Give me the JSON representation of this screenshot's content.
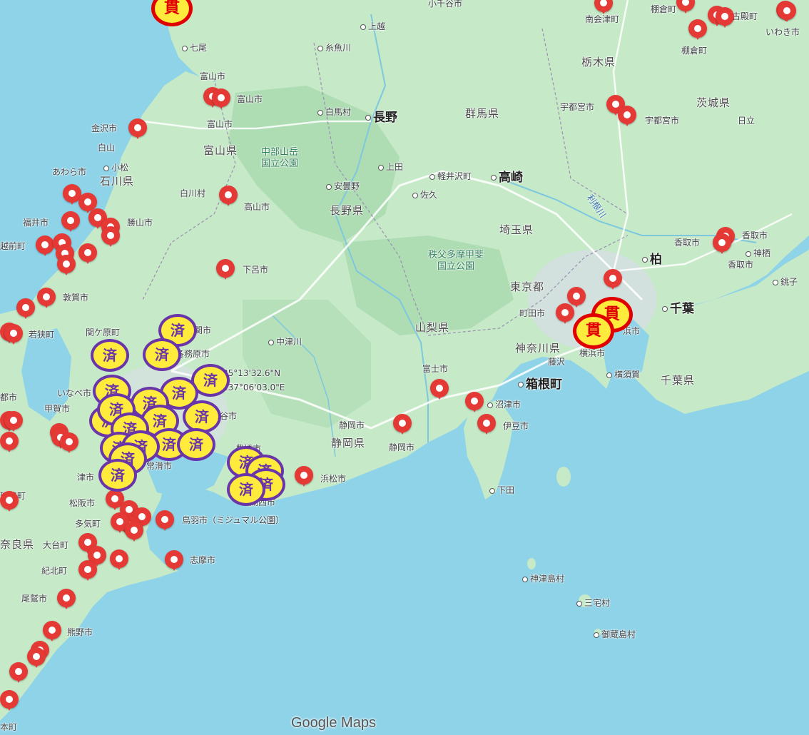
{
  "attribution": "Google Maps",
  "colors": {
    "sea": "#8fd3e8",
    "land": "#bfe6c4",
    "mountain": "#a9d9b0",
    "pin": "#e53935",
    "sumi_border": "#6a35a8",
    "kan_border": "#e00000",
    "marker_fill": "#ffeb3b"
  },
  "coordinate_readout": {
    "lat": "35°13'32.6\"N",
    "lng": "137°06'03.0\"E"
  },
  "marker_text": {
    "sumi": "済",
    "kan": "貫"
  },
  "labels": {
    "komagane": "小千谷市",
    "minamiaizu": "南会津町",
    "tanakura": "棚倉町",
    "furudono": "古殿町",
    "iwaki": "いわき市",
    "tanakura2": "棚倉町",
    "tochigi": "栃木県",
    "ibaraki": "茨城県",
    "utsunomiya": "宇都宮市",
    "utsunomiya2": "宇都宮市",
    "hitachi": "日立",
    "nanao": "七尾",
    "itoigawa": "糸魚川",
    "joetsu": "上越",
    "toyama_city": "富山市",
    "toyama_city2": "富山市",
    "kanazawa": "金沢市",
    "hakusan": "白山",
    "komatsu": "小松",
    "awara": "あわら市",
    "ishikawa": "石川県",
    "fukui": "福井市",
    "echizen": "越前町",
    "katsuyama": "勝山市",
    "hakuba": "白馬村",
    "nagano": "長野",
    "gunma": "群馬県",
    "toyama_pref": "富山県",
    "chubu_park": "中部山岳\n国立公園",
    "joda": "上田",
    "karuizawa": "軽井沢町",
    "takasaki": "高崎",
    "azumino": "安曇野",
    "saku": "佐久",
    "shirakawa": "白川村",
    "takayama": "高山市",
    "nagano_pref": "長野県",
    "saitama": "埼玉県",
    "tone": "利根川",
    "katori": "香取市",
    "katori2": "香取市",
    "kamisu": "神栖",
    "kashiwa": "柏",
    "choshi": "銚子",
    "gero": "下呂市",
    "chichibu_park": "秩父多摩甲斐\n国立公園",
    "tokyo": "東京都",
    "machida": "町田市",
    "chiba": "千葉",
    "tsuruga": "敦賀市",
    "wakasa": "若狭町",
    "sekigahara": "関ケ原町",
    "seki": "関市",
    "kakamigahara": "各務原市",
    "nakatsugawa": "中津川",
    "yamanashi": "山梨県",
    "kanagawa": "神奈川県",
    "fujisawa": "藤沢",
    "yokohama": "横浜市",
    "yokohama2": "浜市",
    "yokosuka": "横須賀",
    "chiba_pref": "千葉県",
    "inabe": "いなべ市",
    "koka": "甲賀市",
    "kariya": "刈谷市",
    "fuji": "富士市",
    "numazu": "沼津市",
    "hakone": "箱根町",
    "izu": "伊豆市",
    "shizuoka_city": "静岡市",
    "shizuoka_city2": "静岡市",
    "shizuoka_pref": "静岡県",
    "toyohashi": "豊橋市",
    "hamamatsu": "浜松市",
    "kosai": "湖西市",
    "tokoname": "常滑市",
    "tsu": "津市",
    "matsusaka": "松阪市",
    "taki": "多気町",
    "toba": "鳥羽市（ミジュマル公園）",
    "shima": "志摩市",
    "nara": "奈良県",
    "odai": "大台町",
    "kihoku": "紀北町",
    "owase": "尾鷲市",
    "kumano": "熊野市",
    "shimoda": "下田",
    "kozushima": "神津島村",
    "miyake": "三宅村",
    "mikurajima": "御蔵島村",
    "ikaruga": "斑鳩町",
    "miyama": "本町",
    "tsu2": "都市"
  }
}
